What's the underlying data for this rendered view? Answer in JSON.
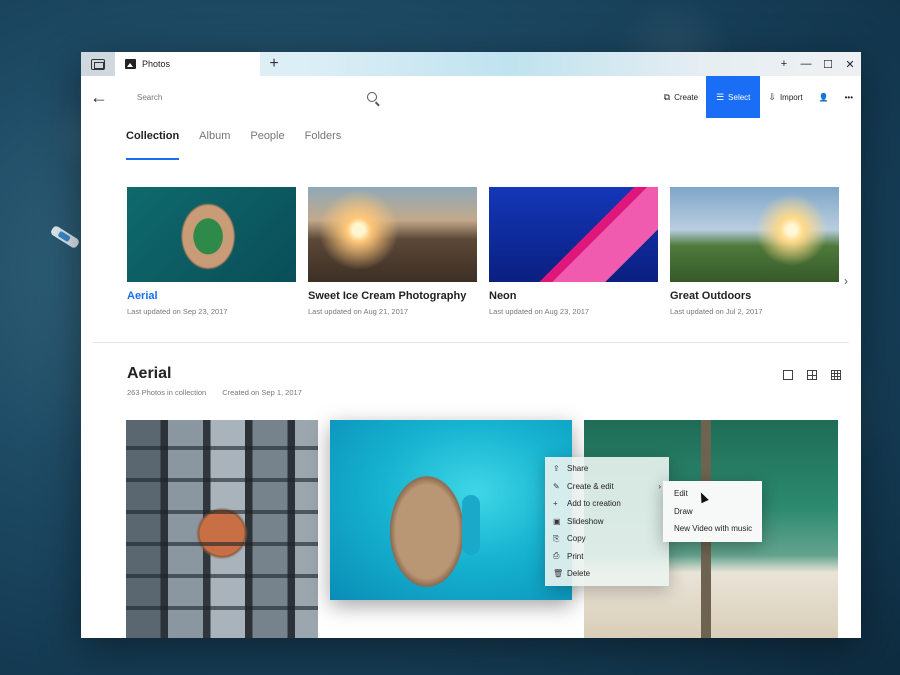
{
  "window": {
    "tab_title": "Photos",
    "new_tab": "+",
    "controls": {
      "add": "+",
      "minimize": "—",
      "maximize": "☐",
      "close": "✕"
    }
  },
  "toolbar": {
    "search_placeholder": "Search",
    "create_label": "Create",
    "select_label": "Select",
    "import_label": "Import",
    "more": "•••",
    "accent": "#1a6ef5"
  },
  "nav": {
    "tabs": [
      "Collection",
      "Album",
      "People",
      "Folders"
    ],
    "active": "Collection"
  },
  "albums": [
    {
      "name": "Aerial",
      "updated": "Last updated on Sep 23, 2017",
      "thumb": "aerial-island"
    },
    {
      "name": "Sweet Ice Cream Photography",
      "updated": "Last updated on Aug 21, 2017",
      "thumb": "sunset-hills"
    },
    {
      "name": "Neon",
      "updated": "Last updated on Aug 23, 2017",
      "thumb": "neon-house"
    },
    {
      "name": "Great Outdoors",
      "updated": "Last updated on Jul 2, 2017",
      "thumb": "sunset-field"
    }
  ],
  "section": {
    "title": "Aerial",
    "count": "263 Photos in collection",
    "created": "Created on Sep 1, 2017"
  },
  "context_menu": {
    "items": [
      {
        "label": "Share",
        "icon": "share-icon"
      },
      {
        "label": "Create & edit",
        "icon": "pen-icon",
        "submenu": true
      },
      {
        "label": "Add to creation",
        "icon": "plus-icon"
      },
      {
        "label": "Slideshow",
        "icon": "slideshow-icon"
      },
      {
        "label": "Copy",
        "icon": "copy-icon"
      },
      {
        "label": "Print",
        "icon": "print-icon"
      },
      {
        "label": "Delete",
        "icon": "trash-icon"
      }
    ],
    "submenu": [
      "Edit",
      "Draw",
      "New Video with music"
    ]
  }
}
